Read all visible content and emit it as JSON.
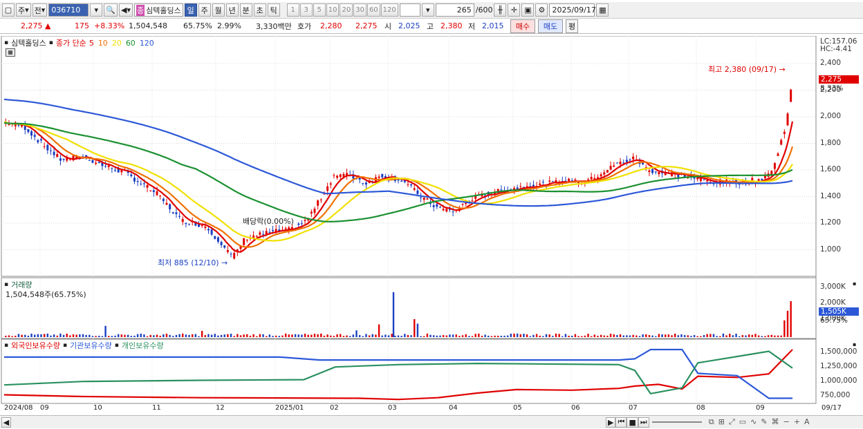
{
  "toolbar": {
    "market": "주",
    "prev": "전",
    "code": "036710",
    "name": "심텍홀딩스",
    "name_tag": "종",
    "periods": [
      "일",
      "주",
      "월",
      "년",
      "분",
      "초",
      "틱"
    ],
    "active_period": "일",
    "intervals": [
      "1",
      "3",
      "5",
      "10",
      "20",
      "30",
      "60",
      "120"
    ],
    "count": "265",
    "count_total": "/600",
    "date": "2025/09/17"
  },
  "info": {
    "price": "2,275",
    "change": "175",
    "change_pct": "+8.33%",
    "volume": "1,504,548",
    "vol_pct": "65.75%",
    "turnover": "2.99%",
    "amount": "3,330백만",
    "hoga_label": "호가",
    "bid": "2,280",
    "ask": "2,275",
    "open_label": "시",
    "open": "2,025",
    "high_label": "고",
    "high": "2,380",
    "low_label": "저",
    "low": "2,015",
    "buy": "매수",
    "sell": "매도",
    "avg": "평"
  },
  "price_panel": {
    "stock": "심텍홀딩스",
    "ma_label": "종가 단순",
    "ma": [
      {
        "period": "5",
        "color": "#e00000"
      },
      {
        "period": "10",
        "color": "#f07000"
      },
      {
        "period": "20",
        "color": "#f0e000"
      },
      {
        "period": "60",
        "color": "#1a9030"
      },
      {
        "period": "120",
        "color": "#2c58d8"
      }
    ],
    "lc": "LC:157.06",
    "hc": "HC:-4.41",
    "last_price": "2,275",
    "last_pct": "8.33%",
    "axis": [
      "2,400",
      "2,200",
      "2,000",
      "1,800",
      "1,600",
      "1,400",
      "1,200",
      "1,000"
    ],
    "annot_high": "최고 2,380 (09/17)",
    "annot_low": "최저 885 (12/10)",
    "annot_div": "배당락(0.00%)"
  },
  "volume_panel": {
    "title": "거래량",
    "value": "1,504,548주(65.75%)",
    "axis": [
      "3,000K",
      "2,000K",
      "1,000K"
    ],
    "last": "1,505K",
    "last_pct": "65.75%"
  },
  "holding_panel": {
    "legend": [
      "외국인보유수량",
      "기관보유수량",
      "개인보유수량"
    ],
    "colors": [
      "#e00000",
      "#2c58d8",
      "#2a9060"
    ],
    "axis": [
      "1,500,000",
      "1,250,000",
      "1,000,000",
      "750,000"
    ]
  },
  "time_axis": [
    "2024/08",
    "09",
    "10",
    "11",
    "12",
    "2025/01",
    "02",
    "03",
    "04",
    "05",
    "06",
    "07",
    "08",
    "09"
  ],
  "time_last": "09/17"
}
